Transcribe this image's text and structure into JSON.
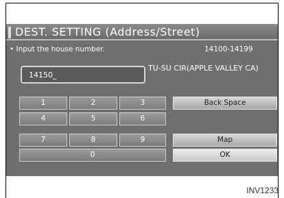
{
  "title": "DEST. SETTING (Address/Street)",
  "instruction": "• Input the house number.",
  "range": "14100-14199",
  "input": {
    "value": "14150_"
  },
  "street_name": "TU-SU CIR(APPLE VALLEY CA)",
  "keys": {
    "k1": "1",
    "k2": "2",
    "k3": "3",
    "k4": "4",
    "k5": "5",
    "k6": "6",
    "k7": "7",
    "k8": "8",
    "k9": "9",
    "k0": "0"
  },
  "buttons": {
    "back_space": "Back Space",
    "map": "Map",
    "ok": "OK"
  },
  "caption": "INV1233"
}
